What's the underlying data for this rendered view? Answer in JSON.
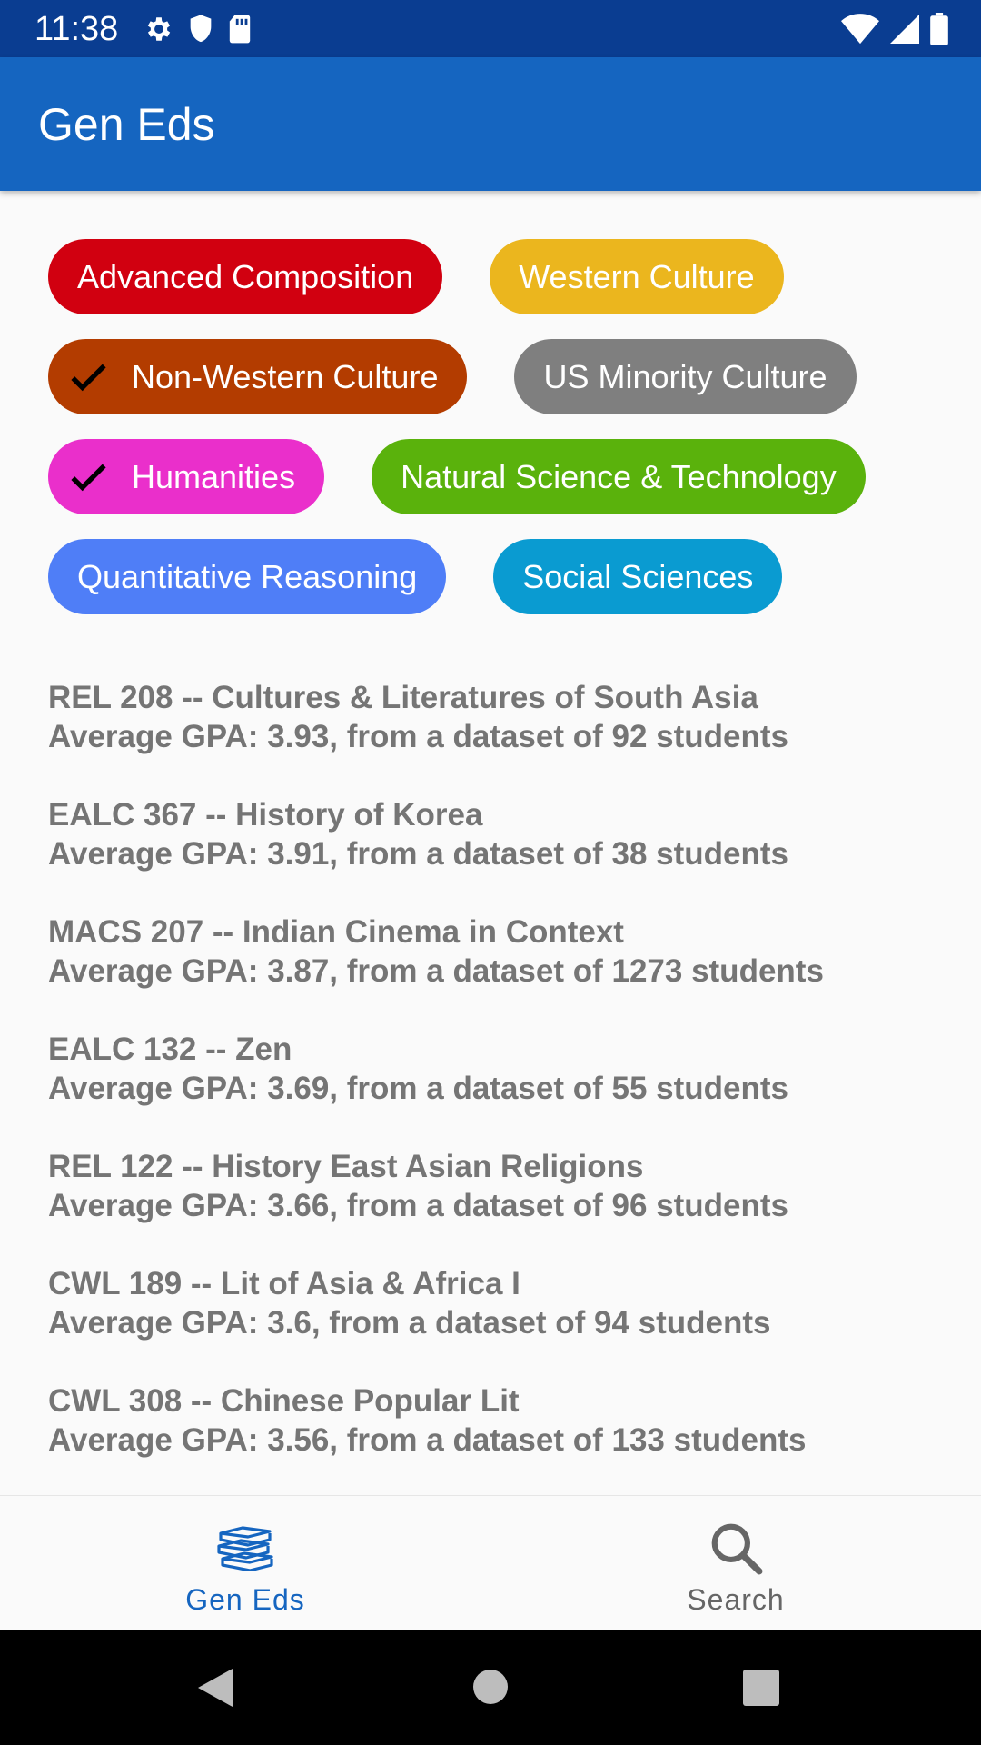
{
  "status_bar": {
    "time": "11:38",
    "left_icons": [
      "settings-icon",
      "shield-icon",
      "sd-card-icon"
    ],
    "right_icons": [
      "wifi-icon",
      "signal-icon",
      "battery-icon"
    ]
  },
  "app_bar": {
    "title": "Gen Eds",
    "color": "#1565c0"
  },
  "chips": [
    {
      "label": "Advanced Composition",
      "color": "#d10010",
      "checked": false
    },
    {
      "label": "Western Culture",
      "color": "#ebb61e",
      "checked": false
    },
    {
      "label": "Non-Western Culture",
      "color": "#b33c00",
      "checked": true
    },
    {
      "label": "US Minority Culture",
      "color": "#7f7f7f",
      "checked": false
    },
    {
      "label": "Humanities",
      "color": "#ea2fcb",
      "checked": true
    },
    {
      "label": "Natural Science & Technology",
      "color": "#5ab20c",
      "checked": false
    },
    {
      "label": "Quantitative Reasoning",
      "color": "#4f7ef7",
      "checked": false
    },
    {
      "label": "Social Sciences",
      "color": "#0a9bd1",
      "checked": false
    }
  ],
  "courses": [
    {
      "title": "REL 208 -- Cultures & Literatures of South Asia",
      "detail": "Average GPA: 3.93, from a dataset of 92 students"
    },
    {
      "title": "EALC 367 -- History of Korea",
      "detail": "Average GPA: 3.91, from a dataset of 38 students"
    },
    {
      "title": "MACS 207 -- Indian Cinema in Context",
      "detail": "Average GPA: 3.87, from a dataset of 1273 students"
    },
    {
      "title": "EALC 132 -- Zen",
      "detail": "Average GPA: 3.69, from a dataset of 55 students"
    },
    {
      "title": "REL 122 -- History East Asian Religions",
      "detail": "Average GPA: 3.66, from a dataset of 96 students"
    },
    {
      "title": "CWL 189 -- Lit of Asia & Africa I",
      "detail": "Average GPA: 3.6, from a dataset of 94 students"
    },
    {
      "title": "CWL 308 -- Chinese Popular Lit",
      "detail": "Average GPA: 3.56, from a dataset of 133 students"
    }
  ],
  "bottom_nav": {
    "items": [
      {
        "label": "Gen Eds",
        "icon": "books-icon",
        "active": true
      },
      {
        "label": "Search",
        "icon": "search-icon",
        "active": false
      }
    ]
  },
  "system_nav": [
    "back-icon",
    "home-icon",
    "recents-icon"
  ]
}
